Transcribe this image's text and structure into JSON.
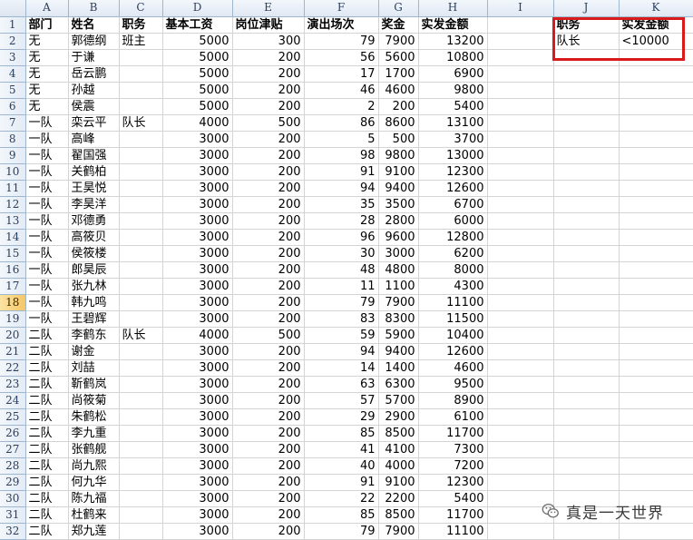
{
  "columns": [
    "A",
    "B",
    "C",
    "D",
    "E",
    "F",
    "G",
    "H",
    "I",
    "J",
    "K"
  ],
  "headers": {
    "dept": "部门",
    "name": "姓名",
    "role": "职务",
    "base": "基本工资",
    "allowance": "岗位津贴",
    "shows": "演出场次",
    "bonus": "奖金",
    "total": "实发金额"
  },
  "criteria": {
    "header_role": "职务",
    "header_total": "实发金额",
    "role": "队长",
    "total": "<10000"
  },
  "rows": [
    [
      "无",
      "郭德纲",
      "班主",
      "5000",
      "300",
      "79",
      "7900",
      "13200"
    ],
    [
      "无",
      "于谦",
      "",
      "5000",
      "200",
      "56",
      "5600",
      "10800"
    ],
    [
      "无",
      "岳云鹏",
      "",
      "5000",
      "200",
      "17",
      "1700",
      "6900"
    ],
    [
      "无",
      "孙越",
      "",
      "5000",
      "200",
      "46",
      "4600",
      "9800"
    ],
    [
      "无",
      "侯震",
      "",
      "5000",
      "200",
      "2",
      "200",
      "5400"
    ],
    [
      "一队",
      "栾云平",
      "队长",
      "4000",
      "500",
      "86",
      "8600",
      "13100"
    ],
    [
      "一队",
      "高峰",
      "",
      "3000",
      "200",
      "5",
      "500",
      "3700"
    ],
    [
      "一队",
      "翟国强",
      "",
      "3000",
      "200",
      "98",
      "9800",
      "13000"
    ],
    [
      "一队",
      "关鹤柏",
      "",
      "3000",
      "200",
      "91",
      "9100",
      "12300"
    ],
    [
      "一队",
      "王昊悦",
      "",
      "3000",
      "200",
      "94",
      "9400",
      "12600"
    ],
    [
      "一队",
      "李昊洋",
      "",
      "3000",
      "200",
      "35",
      "3500",
      "6700"
    ],
    [
      "一队",
      "邓德勇",
      "",
      "3000",
      "200",
      "28",
      "2800",
      "6000"
    ],
    [
      "一队",
      "高筱贝",
      "",
      "3000",
      "200",
      "96",
      "9600",
      "12800"
    ],
    [
      "一队",
      "侯筱楼",
      "",
      "3000",
      "200",
      "30",
      "3000",
      "6200"
    ],
    [
      "一队",
      "郎昊辰",
      "",
      "3000",
      "200",
      "48",
      "4800",
      "8000"
    ],
    [
      "一队",
      "张九林",
      "",
      "3000",
      "200",
      "11",
      "1100",
      "4300"
    ],
    [
      "一队",
      "韩九鸣",
      "",
      "3000",
      "200",
      "79",
      "7900",
      "11100"
    ],
    [
      "一队",
      "王碧辉",
      "",
      "3000",
      "200",
      "83",
      "8300",
      "11500"
    ],
    [
      "二队",
      "李鹤东",
      "队长",
      "4000",
      "500",
      "59",
      "5900",
      "10400"
    ],
    [
      "二队",
      "谢金",
      "",
      "3000",
      "200",
      "94",
      "9400",
      "12600"
    ],
    [
      "二队",
      "刘喆",
      "",
      "3000",
      "200",
      "14",
      "1400",
      "4600"
    ],
    [
      "二队",
      "靳鹤岚",
      "",
      "3000",
      "200",
      "63",
      "6300",
      "9500"
    ],
    [
      "二队",
      "尚筱菊",
      "",
      "3000",
      "200",
      "57",
      "5700",
      "8900"
    ],
    [
      "二队",
      "朱鹤松",
      "",
      "3000",
      "200",
      "29",
      "2900",
      "6100"
    ],
    [
      "二队",
      "李九重",
      "",
      "3000",
      "200",
      "85",
      "8500",
      "11700"
    ],
    [
      "二队",
      "张鹤舰",
      "",
      "3000",
      "200",
      "41",
      "4100",
      "7300"
    ],
    [
      "二队",
      "尚九熙",
      "",
      "3000",
      "200",
      "40",
      "4000",
      "7200"
    ],
    [
      "二队",
      "何九华",
      "",
      "3000",
      "200",
      "91",
      "9100",
      "12300"
    ],
    [
      "二队",
      "陈九福",
      "",
      "3000",
      "200",
      "22",
      "2200",
      "5400"
    ],
    [
      "二队",
      "杜鹤来",
      "",
      "3000",
      "200",
      "85",
      "8500",
      "11700"
    ],
    [
      "二队",
      "郑九莲",
      "",
      "3000",
      "200",
      "79",
      "7900",
      "11100"
    ]
  ],
  "selected_row": 18,
  "watermark": {
    "icon": "wechat-icon",
    "text": "真是一天世界"
  },
  "colors": {
    "highlight": "#d91a1a",
    "header_bg": "#e0e8f3",
    "selected_row_header": "#f6c765"
  }
}
